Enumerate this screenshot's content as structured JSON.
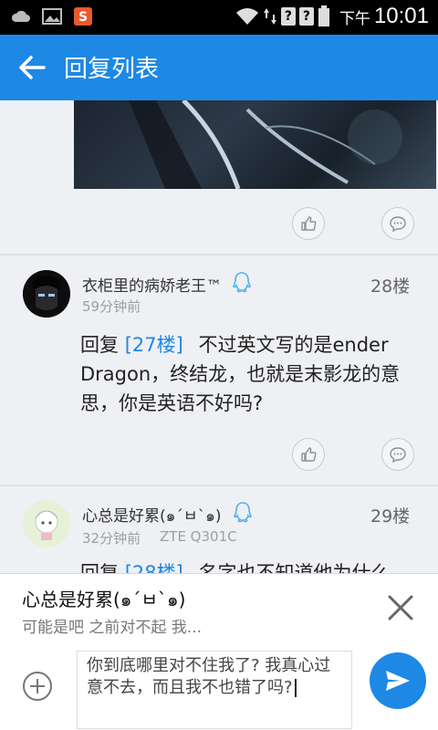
{
  "status_bar": {
    "ampm": "下午",
    "time": "10:01",
    "q_glyph": "?"
  },
  "app_bar": {
    "title": "回复列表"
  },
  "replies": [
    {
      "user": "衣柜里的病娇老王™",
      "time": "59分钟前",
      "device": "",
      "floor": "28楼",
      "reply_word": "回复",
      "reply_to": "[27楼]",
      "text": "不过英文写的是ender Dragon，终结龙，也就是末影龙的意思，你是英语不好吗?"
    },
    {
      "user": "心总是好累(๑´ㅂ`๑)",
      "time": "32分钟前",
      "device": "ZTE Q301C",
      "floor": "29楼",
      "reply_word": "回复",
      "reply_to": "[28楼]",
      "text": "名字也不知道他为什么"
    }
  ],
  "reply_panel": {
    "target_user": "心总是好累(๑´ㅂ`๑)",
    "quote": "可能是吧 之前对不起 我...",
    "input_text": "你到底哪里对不住我了? 我真心过意不去，而且我不也错了吗?"
  },
  "colors": {
    "accent": "#1e88e5",
    "status_bar": "#000000",
    "background": "#eef0f3"
  }
}
